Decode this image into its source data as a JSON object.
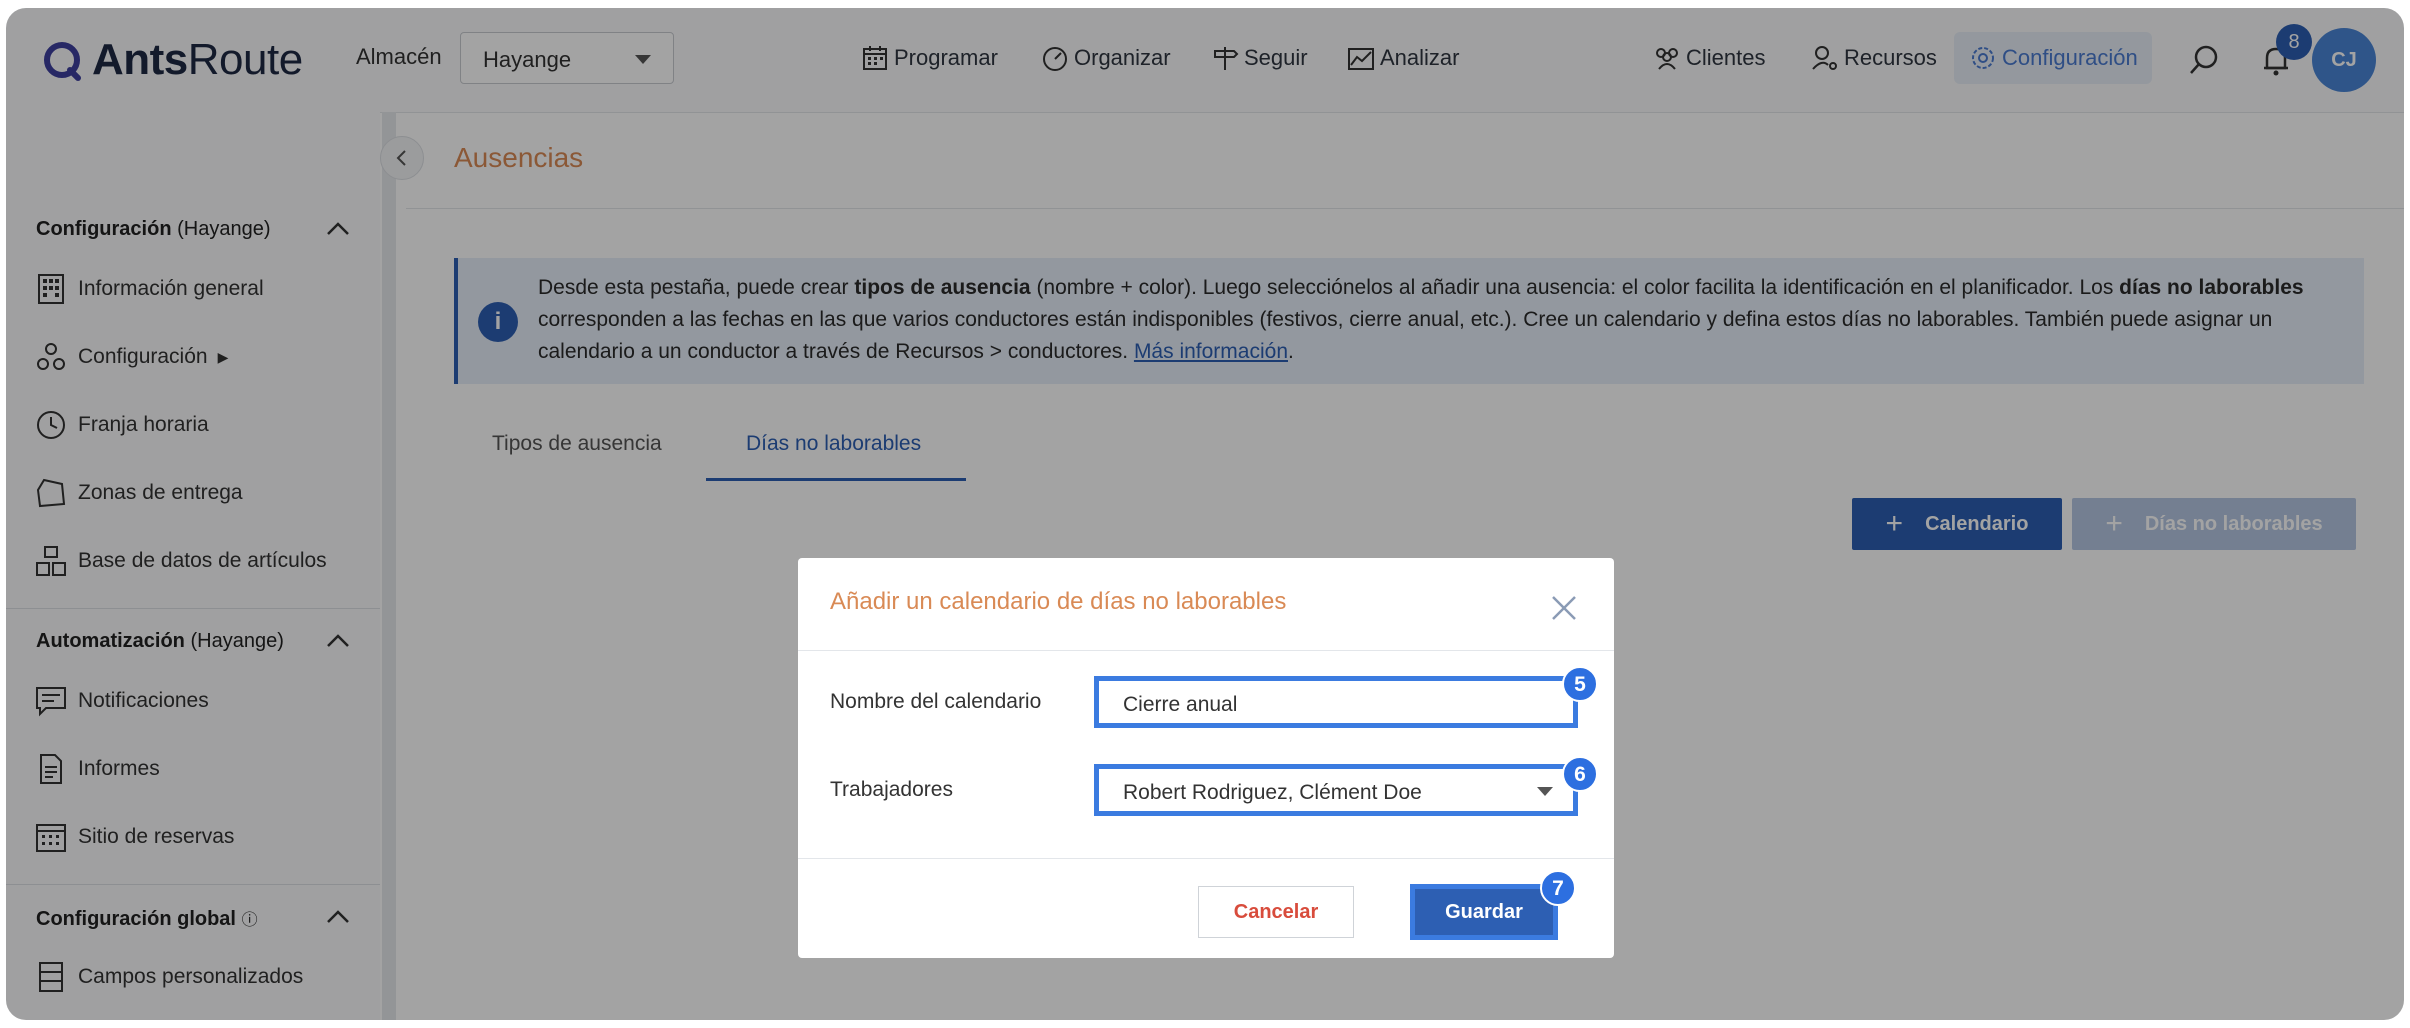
{
  "app": {
    "brand_bold": "Ants",
    "brand_light": "Route"
  },
  "header": {
    "warehouse_label": "Almacén",
    "warehouse_value": "Hayange",
    "nav": [
      "Programar",
      "Organizar",
      "Seguir",
      "Analizar"
    ],
    "right_nav": [
      "Clientes",
      "Recursos",
      "Configuración"
    ],
    "notification_count": "8",
    "avatar_initials": "CJ"
  },
  "sidebar": {
    "sections": [
      {
        "title": "Configuración",
        "context": "(Hayange)",
        "items": [
          "Información general",
          "Configuración",
          "Franja horaria",
          "Zonas de entrega",
          "Base de datos de artículos"
        ]
      },
      {
        "title": "Automatización",
        "context": "(Hayange)",
        "items": [
          "Notificaciones",
          "Informes",
          "Sitio de reservas"
        ]
      },
      {
        "title": "Configuración global",
        "context": "",
        "items": [
          "Campos personalizados"
        ]
      }
    ]
  },
  "main": {
    "page_title": "Ausencias",
    "info": {
      "p1": "Desde esta pestaña, puede crear ",
      "b1": "tipos de ausencia",
      "p2": " (nombre + color). Luego selecciónelos al añadir una ausencia: el color facilita la identificación en el planificador. Los ",
      "b2": "días no laborables",
      "p3": " corresponden a las fechas en las que varios conductores están indisponibles (festivos, cierre anual, etc.). Cree un calendario y defina estos días no laborables. También puede asignar un calendario a un conductor a través de Recursos > conductores. ",
      "link": "Más información",
      "end": "."
    },
    "tabs": [
      "Tipos de ausencia",
      "Días no laborables"
    ],
    "btn_calendar": "Calendario",
    "btn_days": "Días no laborables"
  },
  "modal": {
    "title": "Añadir un calendario de días no laborables",
    "name_label": "Nombre del calendario",
    "name_value": "Cierre anual",
    "workers_label": "Trabajadores",
    "workers_value": "Robert Rodriguez, Clément Doe",
    "cancel": "Cancelar",
    "save": "Guardar",
    "steps": [
      "5",
      "6",
      "7"
    ]
  },
  "colors": {
    "primary": "#2d5fb3",
    "accent": "#d98a55",
    "highlight": "#3b7be0"
  }
}
